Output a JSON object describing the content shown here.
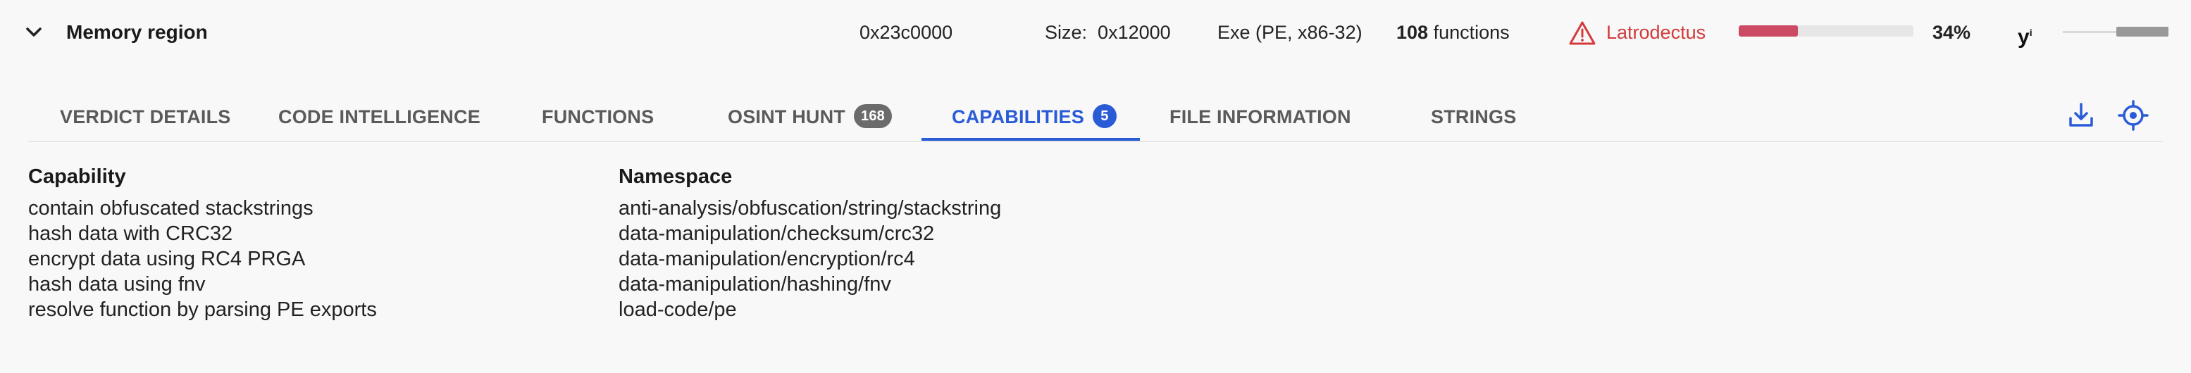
{
  "header": {
    "title": "Memory region",
    "address": "0x23c0000",
    "size_label": "Size:",
    "size_value": "0x12000",
    "file_type": "Exe (PE, x86-32)",
    "functions_count": "108",
    "functions_label": "functions",
    "family": "Latrodectus",
    "match_percent": 34,
    "match_percent_label": "34%",
    "colors": {
      "family": "#d33a3a",
      "match_bar": "#cc4a63",
      "accent": "#2a5bd7"
    }
  },
  "tabs": [
    {
      "label": "VERDICT DETAILS"
    },
    {
      "label": "CODE INTELLIGENCE"
    },
    {
      "label": "FUNCTIONS"
    },
    {
      "label": "OSINT HUNT",
      "badge": "168"
    },
    {
      "label": "CAPABILITIES",
      "badge": "5",
      "active": true
    },
    {
      "label": "FILE INFORMATION"
    },
    {
      "label": "STRINGS"
    }
  ],
  "toolbar_icons": [
    "download-icon",
    "target-icon"
  ],
  "table": {
    "columns": [
      "Capability",
      "Namespace"
    ],
    "rows": [
      {
        "capability": "contain obfuscated stackstrings",
        "namespace": "anti-analysis/obfuscation/string/stackstring"
      },
      {
        "capability": "hash data with CRC32",
        "namespace": "data-manipulation/checksum/crc32"
      },
      {
        "capability": "encrypt data using RC4 PRGA",
        "namespace": "data-manipulation/encryption/rc4"
      },
      {
        "capability": "hash data using fnv",
        "namespace": "data-manipulation/hashing/fnv"
      },
      {
        "capability": "resolve function by parsing PE exports",
        "namespace": "load-code/pe"
      }
    ]
  }
}
